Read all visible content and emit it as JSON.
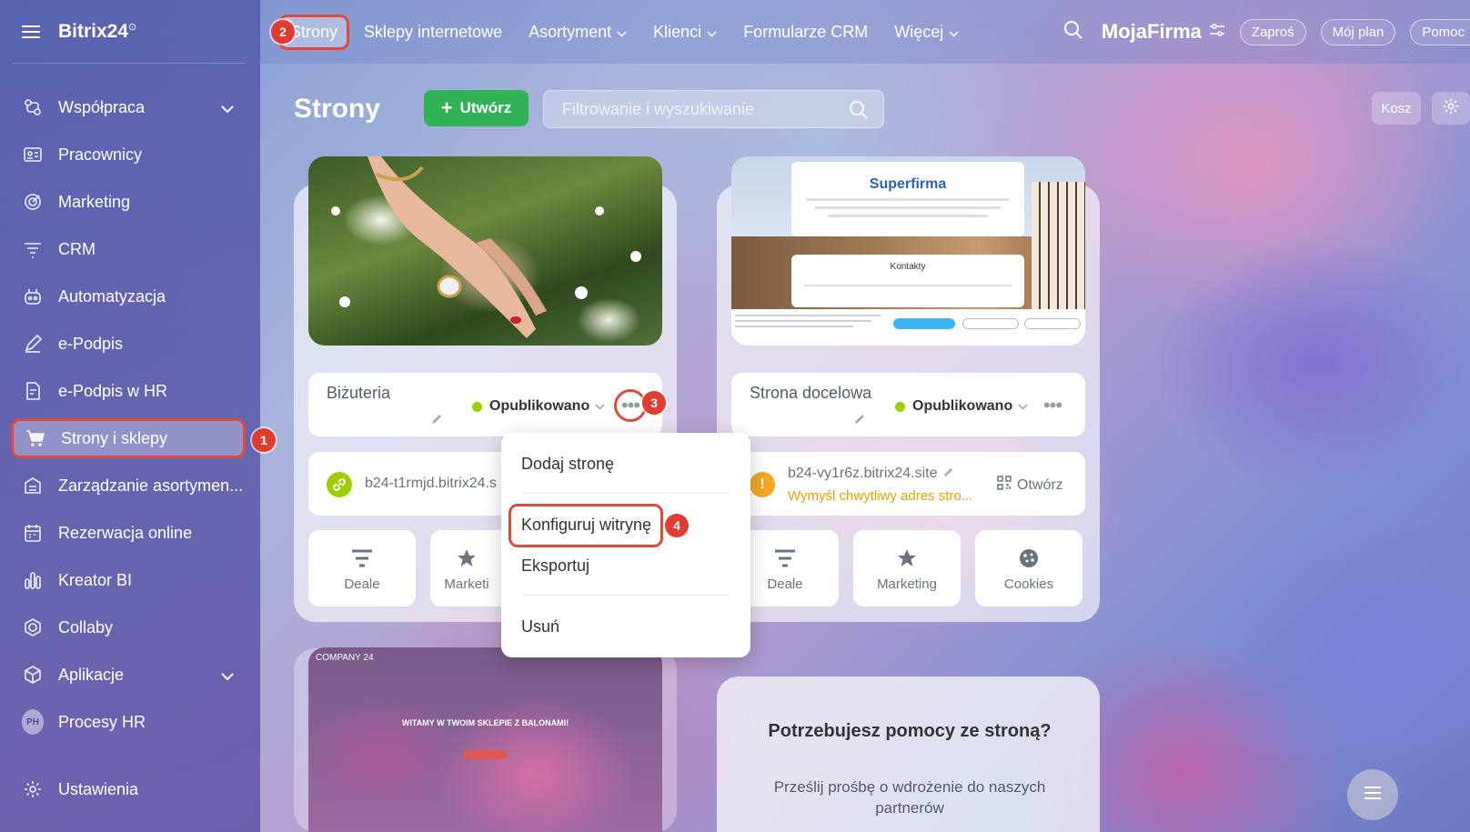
{
  "sidebar": {
    "brand": "Bitrix24",
    "items": [
      {
        "label": "Współpraca",
        "icon": "collaboration-icon"
      },
      {
        "label": "Pracownicy",
        "icon": "employees-icon"
      },
      {
        "label": "Marketing",
        "icon": "marketing-icon"
      },
      {
        "label": "CRM",
        "icon": "crm-icon"
      },
      {
        "label": "Automatyzacja",
        "icon": "automation-icon"
      },
      {
        "label": "e-Podpis",
        "icon": "signature-icon"
      },
      {
        "label": "e-Podpis w HR",
        "icon": "hr-signature-icon"
      },
      {
        "label": "Strony i sklepy",
        "icon": "cart-icon"
      },
      {
        "label": "Zarządzanie asortymen...",
        "icon": "inventory-icon"
      },
      {
        "label": "Rezerwacja online",
        "icon": "calendar-icon"
      },
      {
        "label": "Kreator BI",
        "icon": "bar-chart-icon"
      },
      {
        "label": "Collaby",
        "icon": "hexagon-icon"
      },
      {
        "label": "Aplikacje",
        "icon": "cube-icon"
      },
      {
        "label": "Procesy HR",
        "avatar": "PH"
      },
      {
        "label": "Ustawienia",
        "icon": "gear-icon"
      }
    ]
  },
  "topnav": {
    "items": [
      "Strony",
      "Sklepy internetowe",
      "Asortyment",
      "Klienci",
      "Formularze CRM",
      "Więcej"
    ]
  },
  "header": {
    "company": "MojaFirma",
    "invite": "Zaproś",
    "plan": "Mój plan",
    "help": "Pomoc"
  },
  "page": {
    "title": "Strony",
    "create_label": "Utwórz",
    "search_placeholder": "Filtrowanie i wyszukiwanie",
    "trash_label": "Kosz"
  },
  "sites": [
    {
      "name": "Biżuteria",
      "status": "Opublikowano",
      "url": "b24-t1rmjd.bitrix24.s",
      "actions": [
        "Deale",
        "Marketi"
      ]
    },
    {
      "name": "Strona docelowa",
      "status": "Opublikowano",
      "url": "b24-vy1r6z.bitrix24.site",
      "url_warning": "Wymyśl chwytliwy adres stro...",
      "open_label": "Otwórz",
      "actions": [
        "Deale",
        "Marketing",
        "Cookies"
      ],
      "preview": {
        "title": "Superfirma",
        "contact": "Kontakty"
      }
    }
  ],
  "third_site": {
    "company": "COMPANY 24",
    "headline": "WITAMY W TWOIM SKLEPIE Z BALONAMI!"
  },
  "dropdown": [
    "Dodaj stronę",
    "Konfiguruj witrynę",
    "Eksportuj",
    "Usuń"
  ],
  "help_card": {
    "title": "Potrzebujesz pomocy ze stroną?",
    "text": "Prześlij prośbę o wdrożenie do naszych partnerów"
  },
  "steps": [
    "1",
    "2",
    "3",
    "4"
  ],
  "colors": {
    "accent_green": "#2fb356",
    "highlight_red": "#e04a3a",
    "status_green": "#9dcf00",
    "warning_orange": "#f5a623"
  }
}
